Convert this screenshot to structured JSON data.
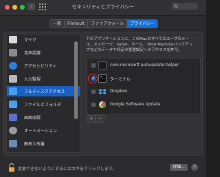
{
  "window": {
    "title": "セキュリティとプライバシー"
  },
  "tabs": [
    {
      "label": "一般",
      "active": false
    },
    {
      "label": "FileVault",
      "active": false
    },
    {
      "label": "ファイアウォール",
      "active": false
    },
    {
      "label": "プライバシー",
      "active": true
    }
  ],
  "sidebar": {
    "items": [
      {
        "label": "マイク",
        "icon": "microphone-icon",
        "selected": false
      },
      {
        "label": "音声認識",
        "icon": "waveform-icon",
        "selected": false
      },
      {
        "label": "アクセシビリティ",
        "icon": "accessibility-icon",
        "selected": false
      },
      {
        "label": "入力監視",
        "icon": "keyboard-icon",
        "selected": false
      },
      {
        "label": "フルディスクアクセス",
        "icon": "folder-icon",
        "selected": true
      },
      {
        "label": "ファイルとフォルダ",
        "icon": "folder-icon",
        "selected": false
      },
      {
        "label": "画面収録",
        "icon": "screen-icon",
        "selected": false
      },
      {
        "label": "オートメーション",
        "icon": "gear-icon",
        "selected": false
      },
      {
        "label": "解析と改善",
        "icon": "chart-icon",
        "selected": false
      }
    ]
  },
  "main": {
    "description_lines": [
      "下のアプリケーションに、このMacのすべてのユーザのメー",
      "ル、メッセージ、Safari、ホーム、Time Machineバックアッ",
      "プなどのデータや特定の管理設定へのアクセスを許可。"
    ],
    "apps": [
      {
        "label": "com.microsoft.autoupdate.helper",
        "checked": false,
        "icon": "generic-app-icon"
      },
      {
        "label": "ターミナル",
        "checked": true,
        "icon": "terminal-icon"
      },
      {
        "label": "Dropbox",
        "checked": false,
        "icon": "dropbox-icon"
      },
      {
        "label": "Google Software Update",
        "checked": false,
        "icon": "google-update-icon"
      }
    ],
    "add_label": "+",
    "remove_label": "−"
  },
  "footer": {
    "lock_text": "変更できないようにするにはカギをクリックします。",
    "details_label": "詳細...",
    "help_label": "?"
  }
}
